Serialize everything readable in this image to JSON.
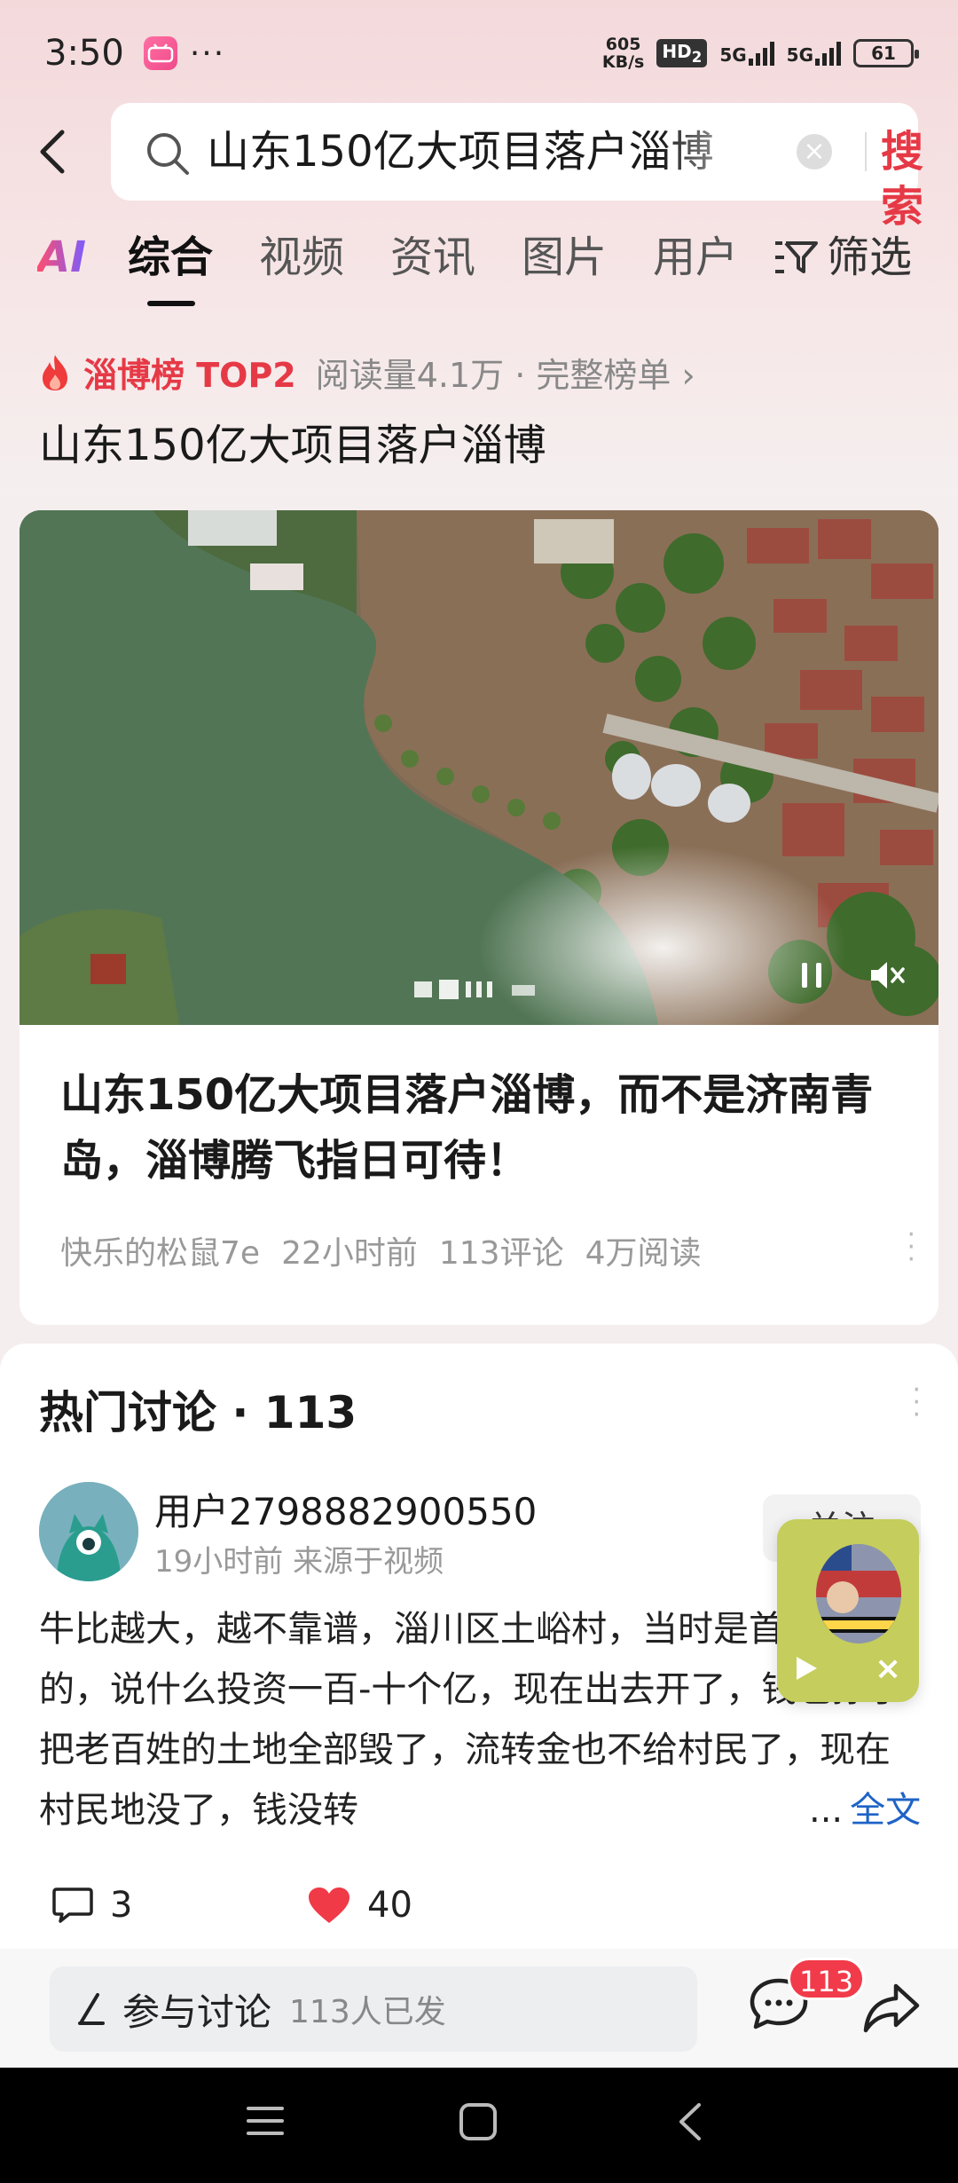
{
  "status_bar": {
    "time": "3:50",
    "app_badge": "bilibili",
    "dots": "···",
    "speed_value": "605",
    "speed_unit": "KB/s",
    "hd": "HD",
    "hd_sub": "2",
    "sig1": "5G",
    "sig2": "5G",
    "battery": "61"
  },
  "search": {
    "query": "山东150亿大项目落户淄博",
    "clear": "×",
    "button": "搜索"
  },
  "tabs": {
    "ai": "AI",
    "items": [
      "综合",
      "视频",
      "资讯",
      "图片",
      "用户"
    ],
    "filter": "筛选"
  },
  "rank": {
    "title": "淄博榜 TOP2",
    "meta": "阅读量4.1万 · 完整榜单 ›"
  },
  "headline": "山东150亿大项目落户淄博",
  "article": {
    "title": "山东150亿大项目落户淄博，而不是济南青岛，淄博腾飞指日可待！",
    "author": "快乐的松鼠7e",
    "time": "22小时前",
    "comments": "113评论",
    "reads": "4万阅读"
  },
  "discussion": {
    "title": "热门讨论 · 113",
    "user": "用户2798882900550",
    "user_meta": "19小时前  来源于视频",
    "follow": "关注",
    "body": "牛比越大，越不靠谱，淄川区土峪村，当时是首旅集团的，说什么投资一百-十个亿，现在出去开了，钱也挣了把老百姓的土地全部毁了，流转金也不给村民了，现在村民地没了，钱没转",
    "more_ellipsis": "...",
    "more_label": "全文",
    "reply_count": "3",
    "like_count": "40"
  },
  "bottom": {
    "participate": "参与讨论",
    "participate_count": "113人已发",
    "comment_badge": "113"
  },
  "colors": {
    "accent_red": "#e63946",
    "link_blue": "#1e63c7",
    "badge_red": "#f23b4a"
  }
}
